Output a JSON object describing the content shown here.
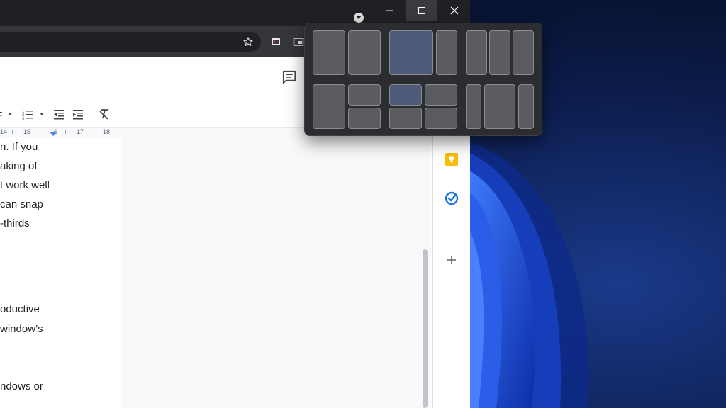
{
  "document": {
    "lines": [
      "n. If you",
      "aking of",
      "t work well",
      "can snap",
      "-thirds",
      "",
      "",
      "",
      "oductive",
      "window’s",
      "",
      "",
      "ndows or"
    ]
  },
  "ruler": {
    "labels": [
      "14",
      "15",
      "16",
      "17",
      "18"
    ]
  },
  "icons": {
    "minimize": "minimize-icon",
    "maximize": "maximize-icon",
    "close": "close-icon",
    "star": "star-icon",
    "comment": "comment-icon",
    "keep": "keep-icon",
    "tasks": "tasks-icon",
    "add": "plus-icon"
  },
  "snap_layouts": {
    "groups": [
      {
        "name": "two-halves"
      },
      {
        "name": "two-thirds-left"
      },
      {
        "name": "three-columns"
      },
      {
        "name": "left-half-right-stack"
      },
      {
        "name": "four-quadrants"
      },
      {
        "name": "wide-center"
      }
    ]
  },
  "colors": {
    "titlebar": "#202124",
    "toolbar": "#35363a",
    "snap_flyout": "#2b2d31",
    "keep_yellow": "#fbbc04",
    "tasks_blue": "#1a73e8"
  }
}
